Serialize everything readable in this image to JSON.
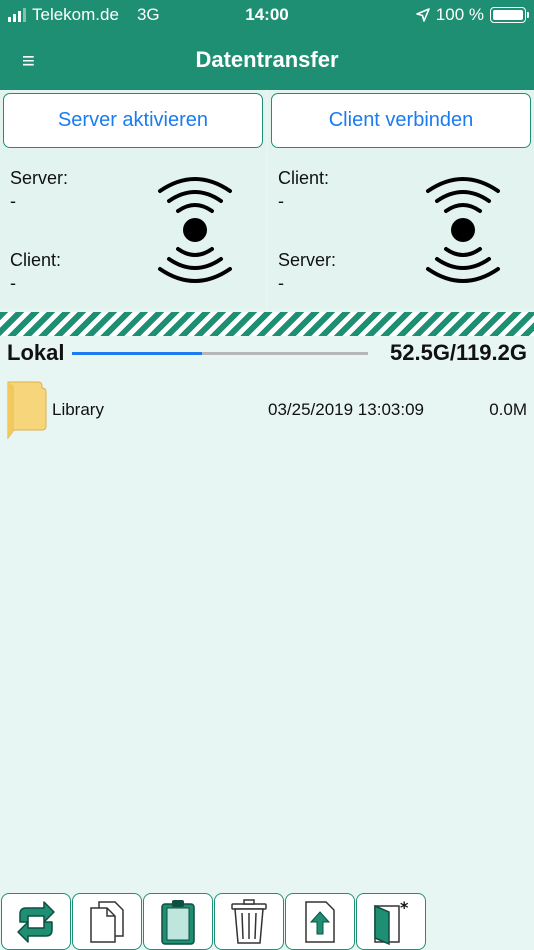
{
  "status_bar": {
    "carrier": "Telekom.de",
    "network": "3G",
    "time": "14:00",
    "battery": "100 %"
  },
  "nav": {
    "title": "Datentransfer",
    "menu_glyph": "≡"
  },
  "server_panel": {
    "button_label": "Server aktivieren",
    "label_1": "Server:",
    "value_1": "-",
    "label_2": "Client:",
    "value_2": "-",
    "icon": "wireless-signal-icon"
  },
  "client_panel": {
    "button_label": "Client verbinden",
    "label_1": "Client:",
    "value_1": "-",
    "label_2": "Server:",
    "value_2": "-",
    "icon": "wireless-signal-icon"
  },
  "storage": {
    "label": "Lokal",
    "usage": "52.5G/119.2G",
    "used_fraction": 0.44
  },
  "files": [
    {
      "name": "Library",
      "date": "03/25/2019 13:03:09",
      "size": "0.0M",
      "icon": "folder-icon"
    }
  ],
  "toolbar": [
    {
      "name": "refresh-icon"
    },
    {
      "name": "copy-icon"
    },
    {
      "name": "paste-icon"
    },
    {
      "name": "trash-icon"
    },
    {
      "name": "upload-icon"
    },
    {
      "name": "new-folder-icon"
    }
  ],
  "colors": {
    "header": "#1f8f74",
    "accent_blue": "#1a7cf0",
    "background": "#e7f6f3",
    "folder": "#f7d57a"
  }
}
